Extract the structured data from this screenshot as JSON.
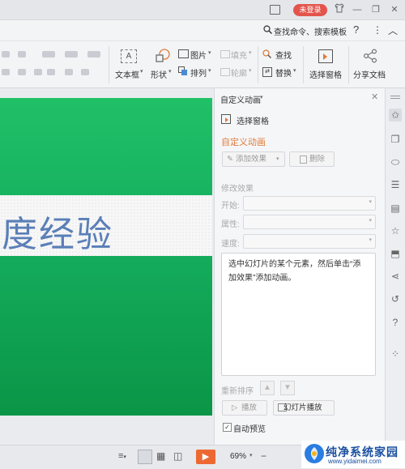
{
  "titlebar": {
    "login_label": "未登录",
    "icons": [
      "frame-icon",
      "shirt-icon",
      "minimize-icon",
      "restore-icon",
      "close-icon"
    ]
  },
  "searchbar": {
    "search_text": "查找命令、搜索模板",
    "help": "?",
    "more": "⋮",
    "collapse": "︿"
  },
  "ribbon": {
    "textbox": "文本框",
    "shape": "形状",
    "picture": "图片",
    "fill": "填充",
    "arrange": "排列",
    "outline": "轮廓",
    "find": "查找",
    "replace": "替换",
    "select_pane": "选择窗格",
    "share": "分享文档"
  },
  "slide": {
    "text": "度经验"
  },
  "pane": {
    "title": "自定义动画",
    "select_pane": "选择窗格",
    "section_title": "自定义动画",
    "add_effect": "添加效果",
    "delete": "删除",
    "modify_title": "修改效果",
    "start_label": "开始:",
    "property_label": "属性:",
    "speed_label": "速度:",
    "description": "选中幻灯片的某个元素，然后单击“添加效果”添加动画。",
    "reorder_label": "重新排序",
    "play": "播放",
    "slideshow": "幻灯片播放",
    "auto_preview": "自动预览"
  },
  "status": {
    "zoom": "69%",
    "minus": "−"
  },
  "watermark": {
    "title": "纯净系统家园",
    "url": "www.yidaimei.com"
  },
  "colors": {
    "accent": "#e3554c",
    "slide_green": "#16b060",
    "orange": "#ec6a32",
    "section_orange": "#e07b39"
  }
}
